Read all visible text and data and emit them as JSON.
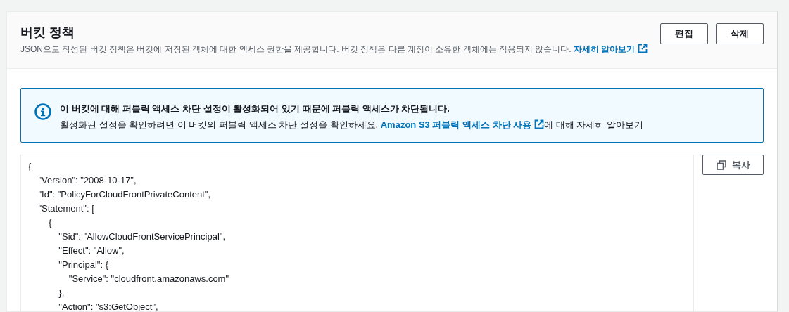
{
  "panel": {
    "title": "버킷 정책",
    "description": "JSON으로 작성된 버킷 정책은 버킷에 저장된 객체에 대한 액세스 권한을 제공합니다. 버킷 정책은 다른 계정이 소유한 객체에는 적용되지 않습니다.",
    "link": "자세히 알아보기",
    "buttons": [
      {
        "label": "편집"
      },
      {
        "label": "삭제"
      }
    ]
  },
  "alert": {
    "kind": "info",
    "title": "이 버킷에 대해 퍼블릭 액세스 차단 설정이 활성화되어 있기 때문에 퍼블릭 액세스가 차단됩니다.",
    "text_before": "활성화된 설정을 확인하려면 이 버킷의 퍼블릭 액세스 차단 설정을 확인하세요.",
    "link": "Amazon S3 퍼블릭 액세스 차단 사용",
    "text_after": "에 대해 자세히 알아보기"
  },
  "policy": {
    "copy_button": "복사",
    "lines": [
      "{",
      "    \"Version\": \"2008-10-17\",",
      "    \"Id\": \"PolicyForCloudFrontPrivateContent\",",
      "    \"Statement\": [",
      "        {",
      "            \"Sid\": \"AllowCloudFrontServicePrincipal\",",
      "            \"Effect\": \"Allow\",",
      "            \"Principal\": {",
      "                \"Service\": \"cloudfront.amazonaws.com\"",
      "            },",
      "            \"Action\": \"s3:GetObject\","
    ]
  }
}
